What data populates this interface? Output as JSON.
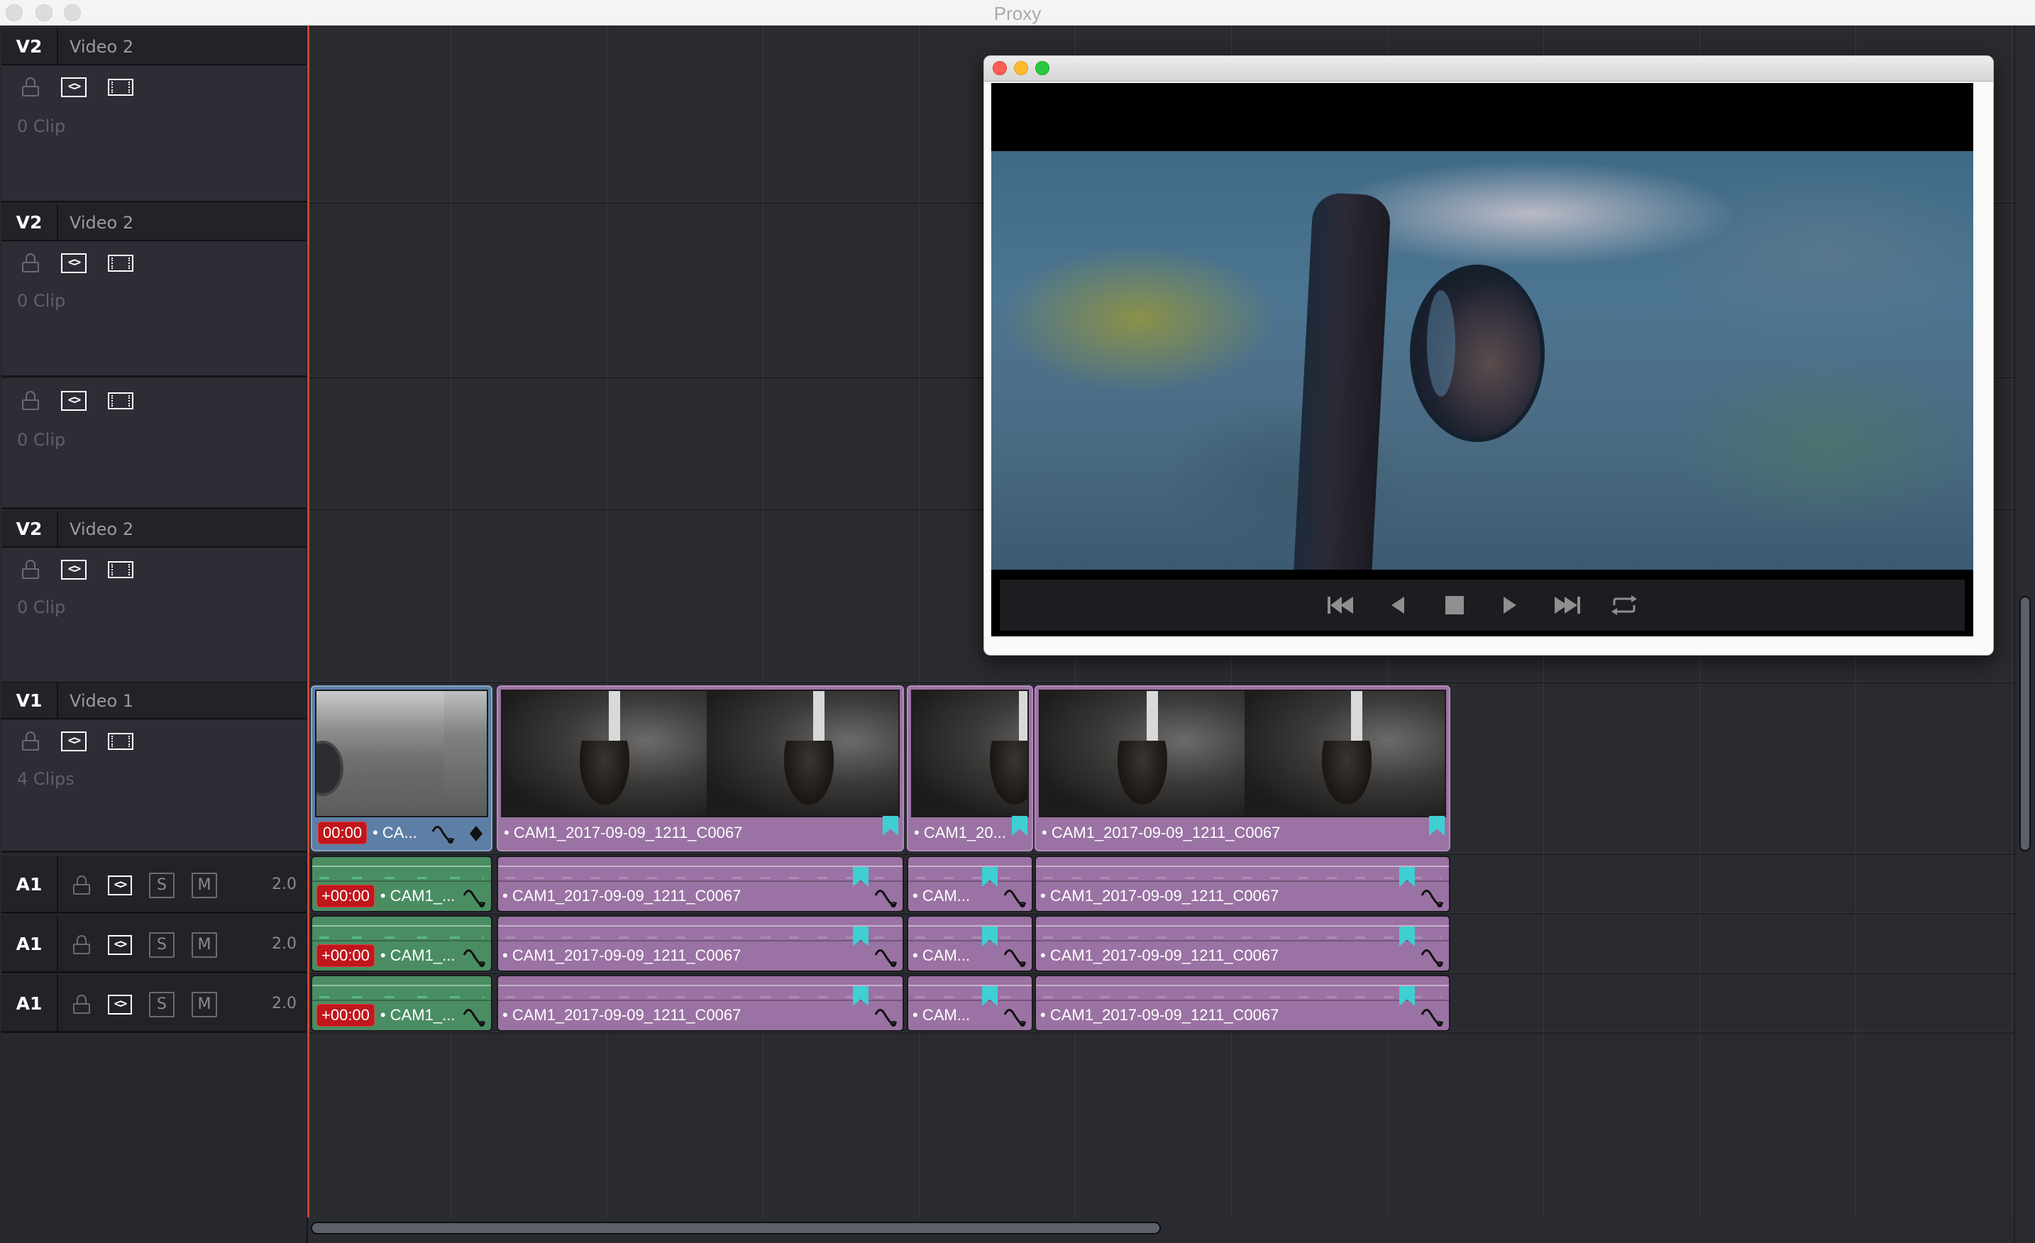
{
  "window": {
    "title": "Proxy"
  },
  "tracks": [
    {
      "code": "V2",
      "name": "Video 2",
      "count": "0 Clip",
      "show_header": true
    },
    {
      "code": "V2",
      "name": "Video 2",
      "count": "0 Clip",
      "show_header": true
    },
    {
      "code": "",
      "name": "",
      "count": "0 Clip",
      "show_header": false
    },
    {
      "code": "V2",
      "name": "Video 2",
      "count": "0 Clip",
      "show_header": true
    },
    {
      "code": "V1",
      "name": "Video 1",
      "count": "4 Clips",
      "show_header": true
    }
  ],
  "audio_tracks": [
    {
      "code": "A1",
      "solo": "S",
      "mute": "M",
      "volume": "2.0"
    },
    {
      "code": "A1",
      "solo": "S",
      "mute": "M",
      "volume": "2.0"
    },
    {
      "code": "A1",
      "solo": "S",
      "mute": "M",
      "volume": "2.0"
    }
  ],
  "video_clips": [
    {
      "name": "CA...",
      "timecode": "00:00",
      "color": "blue",
      "has_marker": false,
      "has_curve": true,
      "has_keyframe": true
    },
    {
      "name": "CAM1_2017-09-09_1211_C0067",
      "timecode": "",
      "color": "purple",
      "has_marker": true,
      "has_curve": false,
      "has_keyframe": false
    },
    {
      "name": "CAM1_20...",
      "timecode": "",
      "color": "purple",
      "has_marker": true,
      "has_curve": false,
      "has_keyframe": false
    },
    {
      "name": "CAM1_2017-09-09_1211_C0067",
      "timecode": "",
      "color": "purple",
      "has_marker": true,
      "has_curve": false,
      "has_keyframe": false
    }
  ],
  "audio_clips": [
    {
      "name": "CAM1_...",
      "timecode": "+00:00",
      "color": "green",
      "has_marker": false
    },
    {
      "name": "CAM1_2017-09-09_1211_C0067",
      "timecode": "",
      "color": "purple",
      "has_marker": true
    },
    {
      "name": "CAM...",
      "timecode": "",
      "color": "purple",
      "has_marker": true
    },
    {
      "name": "CAM1_2017-09-09_1211_C0067",
      "timecode": "",
      "color": "purple",
      "has_marker": true
    }
  ],
  "clip_prefix": "•",
  "colors": {
    "playhead": "#d0442f",
    "clip_purple": "#9a72a3",
    "clip_blue": "#5d7fa6",
    "clip_green": "#4a8d63",
    "timecode_badge": "#c0161c",
    "marker": "#3ecfd3"
  },
  "player": {
    "controls": [
      {
        "name": "skip-to-start",
        "icon": "skip-back-icon"
      },
      {
        "name": "step-back",
        "icon": "play-reverse-icon"
      },
      {
        "name": "stop",
        "icon": "stop-icon"
      },
      {
        "name": "play",
        "icon": "play-icon"
      },
      {
        "name": "skip-to-end",
        "icon": "skip-forward-icon"
      },
      {
        "name": "loop",
        "icon": "loop-icon"
      }
    ]
  },
  "scroll": {
    "horizontal_thumb_fraction": 0.5,
    "vertical_thumb_fraction": 0.21
  }
}
